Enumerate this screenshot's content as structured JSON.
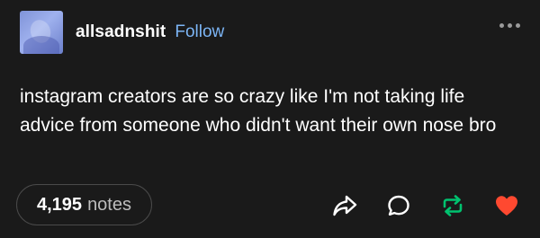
{
  "post": {
    "username": "allsadnshit",
    "follow_label": "Follow",
    "text": "instagram creators are so crazy like I'm not taking life advice from someone who didn't want their own nose bro",
    "notes_count": "4,195",
    "notes_label": "notes"
  },
  "icons": {
    "avatar": "avatar-image",
    "more": "more-options-icon",
    "share": "share-icon",
    "reply": "reply-icon",
    "reblog": "reblog-icon",
    "like": "heart-icon"
  },
  "colors": {
    "background": "#1a1a1a",
    "follow_link": "#7cb5f5",
    "reblog": "#00c26f",
    "like": "#ff4930"
  }
}
